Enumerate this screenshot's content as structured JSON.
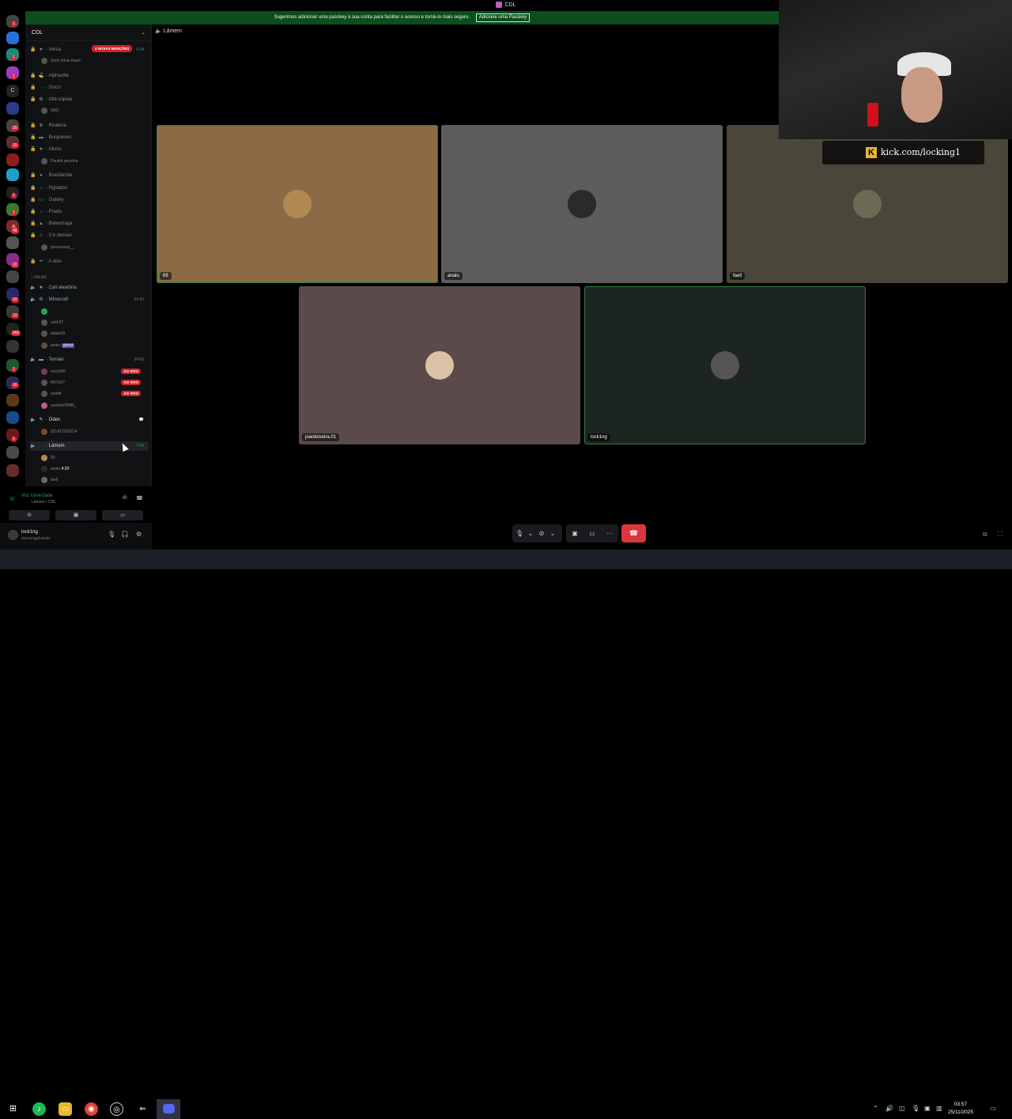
{
  "window": {
    "title": "CDL"
  },
  "notice": {
    "text": "Sugerimos adicionar uma passkey à sua conta para facilitar o acesso e torná-lo mais seguro.",
    "button": "Adicione uma Passkey"
  },
  "rail_badges": [
    "1",
    "1",
    "1",
    "20",
    "10",
    "1",
    "1",
    "6",
    "48",
    "22",
    "10",
    "13",
    "565",
    "1",
    "16",
    "1"
  ],
  "server": {
    "name": "CDL",
    "mentions_badge": "4 NOVAS MENÇÕES"
  },
  "channels": [
    {
      "emoji": "★",
      "name": "· Versa",
      "count": "0:34"
    },
    {
      "emoji": "",
      "name": "Sock ódcia Dudo",
      "member": true
    },
    {
      "emoji": "⛳",
      "name": "· Alphaville"
    },
    {
      "emoji": "·",
      "name": "· Gucci"
    },
    {
      "emoji": "✿",
      "name": "· Alta cúpula"
    },
    {
      "emoji": "",
      "name": "0001",
      "member": true
    },
    {
      "emoji": "♛",
      "name": "· Realeza"
    },
    {
      "emoji": "▬",
      "name": "· Burgueses"
    },
    {
      "emoji": "★",
      "name": "· Ativos"
    },
    {
      "emoji": "",
      "name": "Pauloh pecinha",
      "member": true
    },
    {
      "emoji": "●",
      "name": "· Brasilândia"
    },
    {
      "emoji": "♪",
      "name": "· Hypados"
    },
    {
      "emoji": "▭",
      "name": "· Oakley"
    },
    {
      "emoji": "♪",
      "name": "· Prada"
    },
    {
      "emoji": "▲",
      "name": "· Balenciaga"
    },
    {
      "emoji": "☺",
      "name": "· 3 é demais"
    },
    {
      "emoji": "",
      "name": "possessed__",
      "member": true
    },
    {
      "emoji": "••",
      "name": "· A dois"
    }
  ],
  "category_salas": "| SALAS",
  "salas": {
    "call_aleatoria": "· Call aleatória",
    "minecraft": "· Minecraft",
    "minecraft_count": "04  25",
    "minecraft_members": [
      "",
      "cold.07",
      "adark18",
      "pietro"
    ],
    "pietro_tag": "ghost",
    "temaki": "· Temaki",
    "temaki_count": "04  06",
    "temaki_members": [
      "ozzy396",
      "th07b27",
      "uoufie",
      "yashiro00585_"
    ],
    "live_label": "AO VIVO",
    "oden": "· Oden",
    "oden_members": [
      "321412323214"
    ],
    "lamem": "· Lámem",
    "lamem_time": "7:04",
    "lamem_members": [
      "69",
      "analu",
      "faell"
    ],
    "analu_tag": "4:20"
  },
  "voice_panel": {
    "status": "Voz conectada",
    "location": "Lámem / CDL",
    "buttons": [
      "⊘",
      "▣",
      "⚏"
    ]
  },
  "user": {
    "name": "lock1ng",
    "status": "discord.gg/bolotas",
    "controls": [
      "🎙",
      "🎧",
      "⚙"
    ]
  },
  "call": {
    "channel": "Lámem",
    "participants": [
      {
        "name": "69",
        "tile_color": "#8c6a46",
        "avatar_color": "#b08a52"
      },
      {
        "name": "analu",
        "tile_color": "#5c5c5c",
        "avatar_color": "#2a2a2a"
      },
      {
        "name": "faell",
        "tile_color": "#4a4639",
        "avatar_color": "#6b6b55"
      },
      {
        "name": "joaoteixeira.01",
        "tile_color": "#5a4a4a",
        "avatar_color": "#d9c2a8"
      },
      {
        "name": "lock1ng",
        "tile_color": "#1d2520",
        "avatar_color": "#555"
      }
    ]
  },
  "overlay": {
    "kick_text": "kick.com/locking1",
    "kick_letter": "K"
  },
  "controls": {
    "mic": "🎙",
    "camera": "⊘",
    "screen": "▣",
    "activity": "⚏",
    "more": "···",
    "hangup": "☎"
  },
  "taskbar": {
    "time": "03:57",
    "date": "25/11/2025"
  }
}
